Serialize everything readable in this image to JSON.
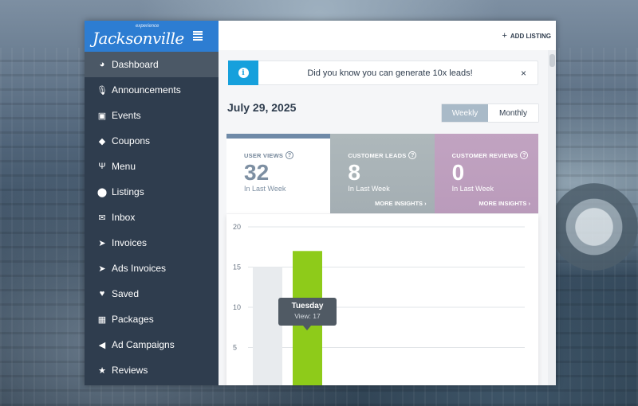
{
  "brand": {
    "small": "experience",
    "name": "Jacksonville"
  },
  "sidebar": {
    "items": [
      {
        "label": "Dashboard",
        "icon": "dashboard-icon",
        "active": true
      },
      {
        "label": "Announcements",
        "icon": "microphone-icon"
      },
      {
        "label": "Events",
        "icon": "calendar-icon"
      },
      {
        "label": "Coupons",
        "icon": "tag-icon"
      },
      {
        "label": "Menu",
        "icon": "fork-knife-icon"
      },
      {
        "label": "Listings",
        "icon": "map-marker-icon"
      },
      {
        "label": "Inbox",
        "icon": "envelope-icon"
      },
      {
        "label": "Invoices",
        "icon": "paper-plane-icon"
      },
      {
        "label": "Ads Invoices",
        "icon": "paper-plane-icon"
      },
      {
        "label": "Saved",
        "icon": "heart-icon"
      },
      {
        "label": "Packages",
        "icon": "gift-icon"
      },
      {
        "label": "Ad Campaigns",
        "icon": "bullhorn-icon"
      },
      {
        "label": "Reviews",
        "icon": "star-icon"
      }
    ]
  },
  "topbar": {
    "add_listing": "ADD LISTING"
  },
  "alert": {
    "text": "Did you know you can generate 10x leads!",
    "close": "×",
    "icon": "i"
  },
  "date": "July 29, 2025",
  "toggle": {
    "weekly": "Weekly",
    "monthly": "Monthly",
    "selected": "Weekly"
  },
  "stats": [
    {
      "label": "USER VIEWS",
      "value": "32",
      "sub": "In Last Week"
    },
    {
      "label": "CUSTOMER LEADS",
      "value": "8",
      "sub": "In Last Week",
      "more": "MORE INSIGHTS"
    },
    {
      "label": "CUSTOMER REVIEWS",
      "value": "0",
      "sub": "In Last Week",
      "more": "MORE INSIGHTS"
    }
  ],
  "chart_data": {
    "type": "bar",
    "y_ticks": [
      "20",
      "15",
      "10",
      "5"
    ],
    "ylim": [
      0,
      20
    ],
    "bars": [
      {
        "value": 15,
        "color": "#e8ebee"
      },
      {
        "value": 17,
        "color": "#8ecb1a"
      }
    ],
    "tooltip": {
      "title": "Tuesday",
      "value": "View: 17"
    }
  }
}
